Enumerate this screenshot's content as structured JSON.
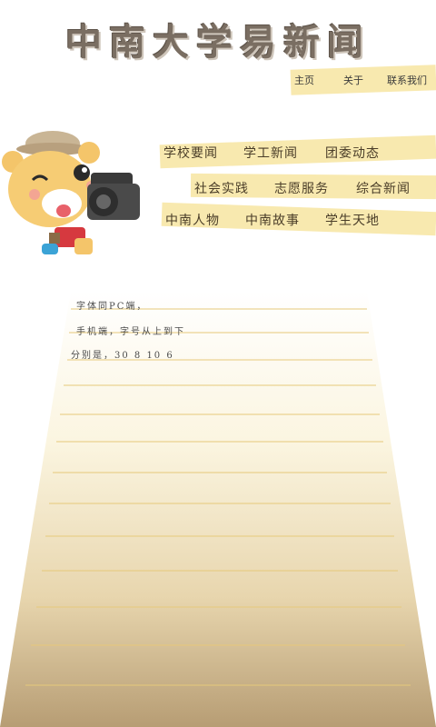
{
  "app": {
    "title": "中南大学易新闻"
  },
  "top_nav": {
    "home": "主页",
    "about": "关于",
    "contact": "联系我们"
  },
  "categories": {
    "row1": [
      "学校要闻",
      "学工新闻",
      "团委动态"
    ],
    "row2": [
      "社会实践",
      "志愿服务",
      "综合新闻"
    ],
    "row3": [
      "中南人物",
      "中南故事",
      "学生天地"
    ]
  },
  "notes": {
    "line1": "字体同PC端，",
    "line2": "手机端，字号从上到下",
    "line3": "分别是，30  8  10  6"
  },
  "colors": {
    "tape": "#f7e7a8",
    "paper_top": "#ffffff",
    "paper_bottom": "#b79d74",
    "rule": "#e6c97a"
  }
}
